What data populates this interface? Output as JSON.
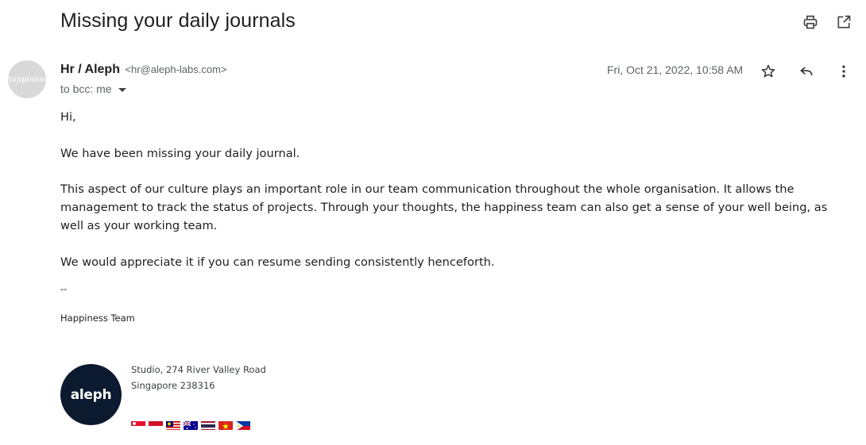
{
  "email": {
    "subject": "Missing your daily journals",
    "sender_name": "Hr / Aleph",
    "sender_email": "<hr@aleph-labs.com>",
    "recipient": "to bcc: me",
    "date": "Fri, Oct 21, 2022, 10:58 AM",
    "avatar_text": "happiness",
    "body": {
      "greeting": "Hi,",
      "p1": "We have been missing your daily journal.",
      "p2": "This aspect of our culture plays an important role in our team communication throughout the whole organisation. It allows the management to track the status of projects. Through your thoughts, the happiness team can also get a sense of your well being, as well as your working team.",
      "p3": "We would appreciate it if you can resume sending consistently henceforth."
    },
    "signature": {
      "separator": "--",
      "team": "Happiness Team",
      "logo_text": "aleph",
      "address_line1": "Studio, 274 River Valley Road",
      "address_line2": "Singapore 238316",
      "flags": [
        "singapore-flag",
        "indonesia-flag",
        "malaysia-flag",
        "australia-flag",
        "thailand-flag",
        "vietnam-flag",
        "philippines-flag"
      ]
    }
  },
  "icons": {
    "print": "print-icon",
    "open_new": "open-in-new-window-icon",
    "star": "star-icon",
    "reply": "reply-icon",
    "more": "more-vert-icon"
  }
}
